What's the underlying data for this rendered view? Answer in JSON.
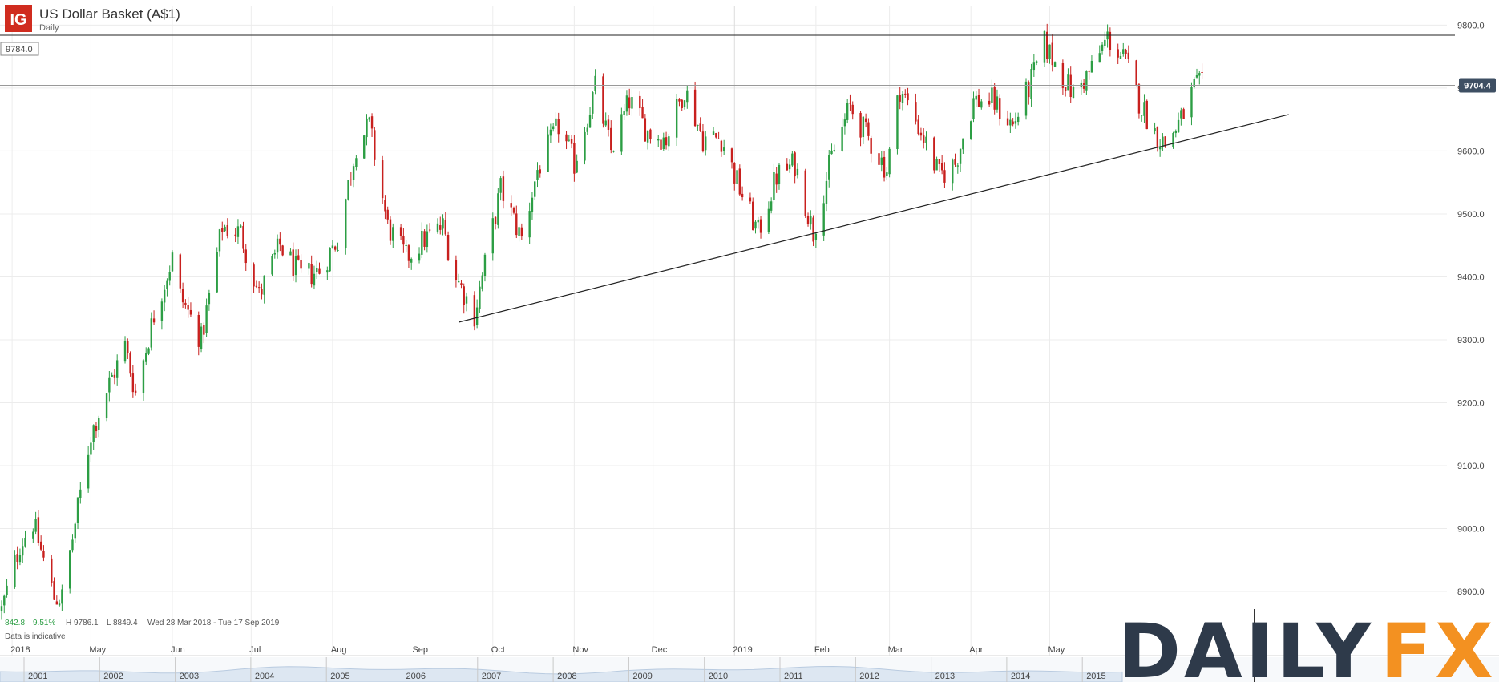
{
  "header": {
    "logo_text": "IG",
    "title": "US Dollar Basket (A$1)",
    "interval": "Daily"
  },
  "stats": {
    "change": "842.8",
    "change_pct": "9.51%",
    "high": "H 9786.1",
    "low": "L 8849.4",
    "range": "Wed 28 Mar 2018 - Tue 17 Sep 2019",
    "note": "Data is indicative"
  },
  "watermark": {
    "part1": "DAILY",
    "part2": "FX"
  },
  "colors": {
    "up": "#2c9e44",
    "down": "#c8201e",
    "grid": "#ececec",
    "line": "#222222",
    "price_tag_bg": "#3e4f63",
    "logo_bg": "#d02c1f",
    "watermark_dark": "#2e3a4a",
    "watermark_orange": "#f39121"
  },
  "chart_data": {
    "type": "candlestick",
    "title": "US Dollar Basket (A$1)",
    "ylim": [
      8830,
      9840
    ],
    "y_ticks": [
      8900,
      9000,
      9100,
      9200,
      9300,
      9400,
      9500,
      9600,
      9700,
      9800
    ],
    "y_tick_labels": [
      "8900.0",
      "9000.0",
      "9100.0",
      "9200.0",
      "9300.0",
      "9400.0",
      "9500.0",
      "9600.0",
      "9700.0",
      "9800.0"
    ],
    "x_range": [
      "2018-03-28",
      "2019-09-17"
    ],
    "x_ticks": [
      {
        "date": "2018-04-01",
        "label": "2018"
      },
      {
        "date": "2018-05-01",
        "label": "May"
      },
      {
        "date": "2018-06-01",
        "label": "Jun"
      },
      {
        "date": "2018-07-01",
        "label": "Jul"
      },
      {
        "date": "2018-08-01",
        "label": "Aug"
      },
      {
        "date": "2018-09-01",
        "label": "Sep"
      },
      {
        "date": "2018-10-01",
        "label": "Oct"
      },
      {
        "date": "2018-11-01",
        "label": "Nov"
      },
      {
        "date": "2018-12-01",
        "label": "Dec"
      },
      {
        "date": "2019-01-01",
        "label": "2019"
      },
      {
        "date": "2019-02-01",
        "label": "Feb"
      },
      {
        "date": "2019-03-01",
        "label": "Mar"
      },
      {
        "date": "2019-04-01",
        "label": "Apr"
      },
      {
        "date": "2019-05-01",
        "label": "May"
      }
    ],
    "resistance": {
      "value": 9784.0,
      "label": "9784.0"
    },
    "last_price": {
      "value": 9704.4,
      "label": "9704.4"
    },
    "trendline": [
      {
        "date": "2018-09-18",
        "value": 9328
      },
      {
        "date": "2019-07-31",
        "value": 9658
      }
    ],
    "price_path": [
      {
        "date": "2018-03-28",
        "value": 8870
      },
      {
        "date": "2018-04-04",
        "value": 8975
      },
      {
        "date": "2018-04-09",
        "value": 9010
      },
      {
        "date": "2018-04-17",
        "value": 8890
      },
      {
        "date": "2018-04-20",
        "value": 8890
      },
      {
        "date": "2018-05-01",
        "value": 9150
      },
      {
        "date": "2018-05-08",
        "value": 9230
      },
      {
        "date": "2018-05-14",
        "value": 9290
      },
      {
        "date": "2018-05-18",
        "value": 9215
      },
      {
        "date": "2018-05-25",
        "value": 9340
      },
      {
        "date": "2018-06-01",
        "value": 9430
      },
      {
        "date": "2018-06-04",
        "value": 9370
      },
      {
        "date": "2018-06-12",
        "value": 9300
      },
      {
        "date": "2018-06-20",
        "value": 9480
      },
      {
        "date": "2018-06-27",
        "value": 9470
      },
      {
        "date": "2018-07-04",
        "value": 9370
      },
      {
        "date": "2018-07-12",
        "value": 9450
      },
      {
        "date": "2018-07-20",
        "value": 9400
      },
      {
        "date": "2018-07-27",
        "value": 9410
      },
      {
        "date": "2018-08-03",
        "value": 9460
      },
      {
        "date": "2018-08-10",
        "value": 9610
      },
      {
        "date": "2018-08-15",
        "value": 9640
      },
      {
        "date": "2018-08-22",
        "value": 9480
      },
      {
        "date": "2018-08-29",
        "value": 9430
      },
      {
        "date": "2018-09-05",
        "value": 9460
      },
      {
        "date": "2018-09-12",
        "value": 9480
      },
      {
        "date": "2018-09-17",
        "value": 9400
      },
      {
        "date": "2018-09-24",
        "value": 9340
      },
      {
        "date": "2018-10-04",
        "value": 9540
      },
      {
        "date": "2018-10-12",
        "value": 9460
      },
      {
        "date": "2018-10-18",
        "value": 9570
      },
      {
        "date": "2018-10-26",
        "value": 9640
      },
      {
        "date": "2018-11-01",
        "value": 9580
      },
      {
        "date": "2018-11-09",
        "value": 9700
      },
      {
        "date": "2018-11-15",
        "value": 9600
      },
      {
        "date": "2018-11-22",
        "value": 9680
      },
      {
        "date": "2018-11-29",
        "value": 9630
      },
      {
        "date": "2018-12-06",
        "value": 9620
      },
      {
        "date": "2018-12-13",
        "value": 9700
      },
      {
        "date": "2018-12-20",
        "value": 9620
      },
      {
        "date": "2018-12-27",
        "value": 9620
      },
      {
        "date": "2019-01-03",
        "value": 9540
      },
      {
        "date": "2019-01-10",
        "value": 9470
      },
      {
        "date": "2019-01-17",
        "value": 9560
      },
      {
        "date": "2019-01-24",
        "value": 9580
      },
      {
        "date": "2019-01-31",
        "value": 9470
      },
      {
        "date": "2019-02-07",
        "value": 9590
      },
      {
        "date": "2019-02-14",
        "value": 9670
      },
      {
        "date": "2019-02-21",
        "value": 9620
      },
      {
        "date": "2019-02-28",
        "value": 9570
      },
      {
        "date": "2019-03-05",
        "value": 9700
      },
      {
        "date": "2019-03-12",
        "value": 9640
      },
      {
        "date": "2019-03-20",
        "value": 9560
      },
      {
        "date": "2019-03-26",
        "value": 9580
      },
      {
        "date": "2019-04-02",
        "value": 9680
      },
      {
        "date": "2019-04-09",
        "value": 9680
      },
      {
        "date": "2019-04-17",
        "value": 9640
      },
      {
        "date": "2019-04-23",
        "value": 9700
      },
      {
        "date": "2019-04-29",
        "value": 9770
      },
      {
        "date": "2019-05-03",
        "value": 9740
      },
      {
        "date": "2019-05-10",
        "value": 9690
      },
      {
        "date": "2019-05-17",
        "value": 9730
      },
      {
        "date": "2019-05-23",
        "value": 9780
      },
      {
        "date": "2019-05-30",
        "value": 9740
      },
      {
        "date": "2019-06-04",
        "value": 9680
      },
      {
        "date": "2019-06-10",
        "value": 9630
      },
      {
        "date": "2019-06-14",
        "value": 9610
      },
      {
        "date": "2019-06-20",
        "value": 9650
      },
      {
        "date": "2019-06-25",
        "value": 9700
      },
      {
        "date": "2019-06-28",
        "value": 9704
      }
    ],
    "navigator": {
      "years": [
        "2001",
        "2002",
        "2003",
        "2004",
        "2005",
        "2006",
        "2007",
        "2008",
        "2009",
        "2010",
        "2011",
        "2012",
        "2013",
        "2014",
        "2015"
      ]
    }
  }
}
